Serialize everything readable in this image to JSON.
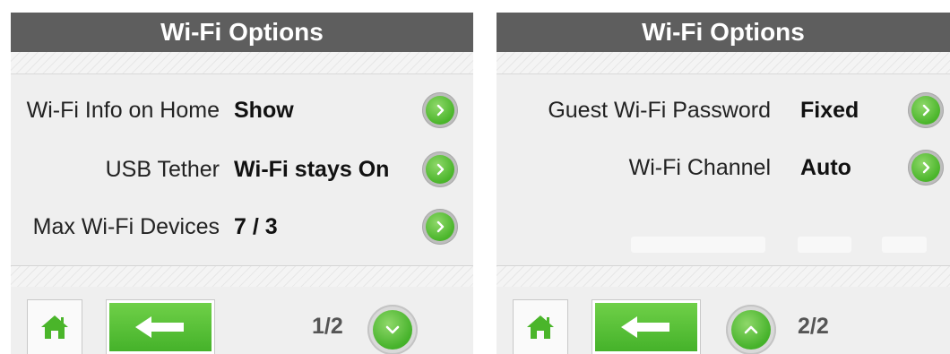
{
  "screens": [
    {
      "title": "Wi-Fi Options",
      "rows": [
        {
          "label": "Wi-Fi Info on Home",
          "value": "Show"
        },
        {
          "label": "USB Tether",
          "value": "Wi-Fi stays On"
        },
        {
          "label": "Max Wi-Fi Devices",
          "value": "7 / 3"
        }
      ],
      "page_indicator": "1/2",
      "page_nav_icon": "chevron-down-icon"
    },
    {
      "title": "Wi-Fi Options",
      "rows": [
        {
          "label": "Guest Wi-Fi Password",
          "value": "Fixed"
        },
        {
          "label": "Wi-Fi Channel",
          "value": "Auto"
        }
      ],
      "page_indicator": "2/2",
      "page_nav_icon": "chevron-up-icon"
    }
  ],
  "icons": {
    "row_action": "chevron-right-icon",
    "home": "home-icon",
    "back": "back-arrow-icon"
  },
  "colors": {
    "accent_green": "#4ab52a",
    "title_bar": "#5e5e5e",
    "screen_background": "#efefef"
  }
}
